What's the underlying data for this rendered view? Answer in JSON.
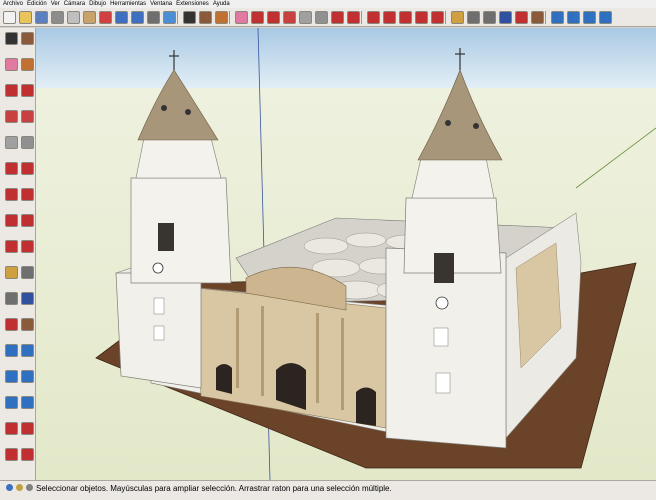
{
  "menu": [
    "Archivo",
    "Edición",
    "Ver",
    "Cámara",
    "Dibujo",
    "Herramientas",
    "Ventana",
    "Extensiones",
    "Ayuda"
  ],
  "toolbar_icons": [
    {
      "name": "new-file-icon",
      "color": "#f2f2f2"
    },
    {
      "name": "open-file-icon",
      "color": "#e9c45a"
    },
    {
      "name": "save-icon",
      "color": "#5b7fbf"
    },
    {
      "name": "cut-icon",
      "color": "#8c8c8c"
    },
    {
      "name": "copy-icon",
      "color": "#bfbfbf"
    },
    {
      "name": "paste-icon",
      "color": "#c9a46a"
    },
    {
      "name": "erase-icon",
      "color": "#d04040"
    },
    {
      "name": "undo-icon",
      "color": "#3f6fbf"
    },
    {
      "name": "redo-icon",
      "color": "#3f6fbf"
    },
    {
      "name": "print-icon",
      "color": "#6f6f6f"
    },
    {
      "name": "model-info-icon",
      "color": "#4a8fd6"
    },
    {
      "name": "select-icon",
      "color": "#333333"
    },
    {
      "name": "component-icon",
      "color": "#8a5a3a"
    },
    {
      "name": "paint-bucket-icon",
      "color": "#c07030"
    },
    {
      "name": "eraser-icon",
      "color": "#e07aa0"
    },
    {
      "name": "line-icon",
      "color": "#c03030"
    },
    {
      "name": "arc-icon",
      "color": "#c03030"
    },
    {
      "name": "rectangle-icon",
      "color": "#c84040"
    },
    {
      "name": "circle-icon",
      "color": "#a0a0a0"
    },
    {
      "name": "polygon-icon",
      "color": "#909090"
    },
    {
      "name": "freehand-icon",
      "color": "#c03030"
    },
    {
      "name": "push-pull-icon",
      "color": "#c03030"
    },
    {
      "name": "move-icon",
      "color": "#c03030"
    },
    {
      "name": "rotate-icon",
      "color": "#c03030"
    },
    {
      "name": "follow-me-icon",
      "color": "#c03030"
    },
    {
      "name": "scale-icon",
      "color": "#c03030"
    },
    {
      "name": "offset-icon",
      "color": "#c03030"
    },
    {
      "name": "tape-measure-icon",
      "color": "#d0a040"
    },
    {
      "name": "dimension-icon",
      "color": "#6f6f6f"
    },
    {
      "name": "protractor-icon",
      "color": "#6f6f6f"
    },
    {
      "name": "text-icon",
      "color": "#3050a0"
    },
    {
      "name": "axes-icon",
      "color": "#c03030"
    },
    {
      "name": "3d-text-icon",
      "color": "#8a5a3a"
    },
    {
      "name": "orbit-icon",
      "color": "#3070c0"
    },
    {
      "name": "pan-icon",
      "color": "#3070c0"
    },
    {
      "name": "zoom-icon",
      "color": "#3070c0"
    },
    {
      "name": "zoom-extents-icon",
      "color": "#3070c0"
    }
  ],
  "left_toolbar_icons": [
    "select-icon",
    "component-icon",
    "eraser-icon",
    "paint-bucket-icon",
    "line-icon",
    "freehand-icon",
    "rectangle-icon",
    "rotated-rectangle-icon",
    "circle-icon",
    "polygon-icon",
    "arc-icon",
    "pie-icon",
    "move-icon",
    "push-pull-icon",
    "rotate-icon",
    "follow-me-icon",
    "scale-icon",
    "offset-icon",
    "tape-measure-icon",
    "dimension-icon",
    "protractor-icon",
    "text-icon",
    "axes-icon",
    "3d-text-icon",
    "orbit-icon",
    "pan-icon",
    "zoom-icon",
    "zoom-window-icon",
    "zoom-extents-icon",
    "previous-view-icon",
    "position-camera-icon",
    "walk-icon",
    "look-around-icon",
    "section-plane-icon"
  ],
  "status_text": "Seleccionar objetos. Mayúsculas para ampliar selección. Arrastrar raton para una selección múltiple.",
  "colors": {
    "sky": "#c9dce8",
    "ground": "#e6ecd0",
    "base": "#6a4328",
    "facade_white": "#f1efe9",
    "facade_stone": "#d9c7a3",
    "roof": "#bfb8a6",
    "dome": "#a8967a"
  }
}
